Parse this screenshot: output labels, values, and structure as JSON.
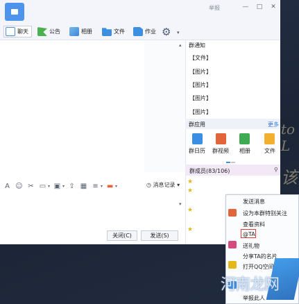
{
  "titlebar": {
    "report": "举报",
    "minimize": "—",
    "maximize": "□",
    "close": "✕"
  },
  "toolbar": {
    "tabs": [
      {
        "label": "聊天"
      },
      {
        "label": "公告"
      },
      {
        "label": "相册"
      },
      {
        "label": "文件"
      },
      {
        "label": "作业"
      }
    ],
    "settings_icon": "⚙",
    "caret": "▾"
  },
  "edit_toolbar": {
    "font_icon": "A",
    "emoji_icon": "☺",
    "tool_icon": "✂",
    "history_label": "消息记录",
    "caret": "▾"
  },
  "buttons": {
    "close": "关闭(C)",
    "send": "发送(S)"
  },
  "notice": {
    "title": "群通知",
    "items": [
      "【文件】",
      "【图片】",
      "【图片】",
      "【图片】",
      "【图片】"
    ]
  },
  "apps": {
    "title": "群应用",
    "more": "更多",
    "items": [
      {
        "label": "群日历",
        "color": "#3a8fe2"
      },
      {
        "label": "群视频",
        "color": "#e2643a"
      },
      {
        "label": "相册",
        "color": "#3cab52"
      },
      {
        "label": "文件",
        "color": "#f2b030"
      }
    ]
  },
  "members": {
    "title": "群成员(83/106)"
  },
  "context_menu": {
    "items": [
      "发送消息",
      "设为本群特别关注",
      "查看资料",
      "@TA",
      "送礼物",
      "分享TA的名片",
      "打开QQ空间",
      "举报此人"
    ]
  },
  "watermark": {
    "text": "河南龙网"
  },
  "background": {
    "scrawl_1": "to L",
    "scrawl_2": "该"
  }
}
